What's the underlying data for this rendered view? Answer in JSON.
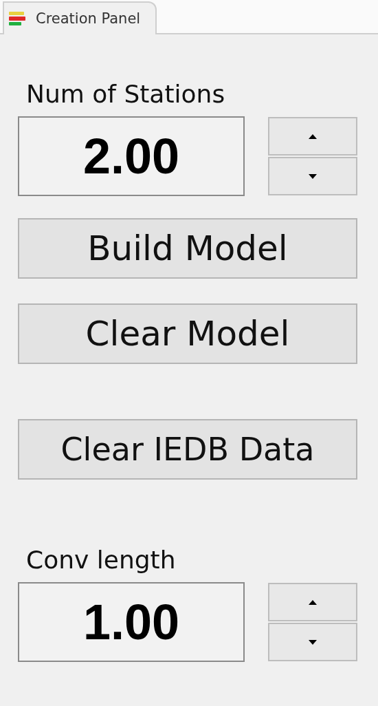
{
  "tab": {
    "label": "Creation Panel",
    "selected": true
  },
  "stations": {
    "label": "Num of Stations",
    "value": "2.00"
  },
  "buttons": [
    "Build Model",
    "Clear Model",
    "Clear IEDB Data"
  ],
  "conv": {
    "label": "Conv length",
    "value": "1.00"
  }
}
